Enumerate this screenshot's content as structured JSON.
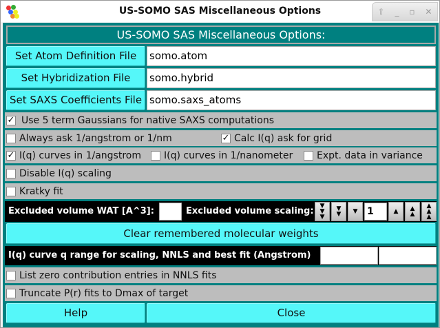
{
  "window": {
    "title": "US-SOMO SAS Miscellaneous Options"
  },
  "header": "US-SOMO SAS Miscellaneous Options:",
  "files": [
    {
      "button": "Set Atom Definition File",
      "value": "somo.atom"
    },
    {
      "button": "Set Hybridization File",
      "value": "somo.hybrid"
    },
    {
      "button": "Set SAXS Coefficients File",
      "value": "somo.saxs_atoms"
    }
  ],
  "checks": {
    "gauss5": {
      "label": "Use 5 term Gaussians for native SAXS computations",
      "checked": true
    },
    "always_ask": {
      "label": "Always ask 1/angstrom or 1/nm",
      "checked": false
    },
    "calc_grid": {
      "label": "Calc I(q) ask for grid",
      "checked": true
    },
    "iq_ang": {
      "label": "I(q) curves in 1/angstrom",
      "checked": true
    },
    "iq_nm": {
      "label": "I(q) curves in 1/nanometer",
      "checked": false
    },
    "expt_var": {
      "label": "Expt. data in variance",
      "checked": false
    },
    "disable_scaling": {
      "label": "Disable I(q) scaling",
      "checked": false
    },
    "kratky": {
      "label": "Kratky fit",
      "checked": false
    },
    "list_zero": {
      "label": "List zero contribution entries in NNLS fits",
      "checked": false
    },
    "truncate": {
      "label": "Truncate P(r) fits to Dmax of target",
      "checked": false
    }
  },
  "excluded": {
    "wat_label": "Excluded volume WAT [A^3]:",
    "wat_value": "",
    "scaling_label": "Excluded volume scaling:",
    "scaling_value": "1"
  },
  "clear_button": "Clear remembered molecular weights",
  "qrange": {
    "label": "I(q) curve q range for scaling, NNLS and best fit (Angstrom)",
    "min": "",
    "max": ""
  },
  "footer": {
    "help": "Help",
    "close": "Close"
  },
  "check_mark": "✓"
}
